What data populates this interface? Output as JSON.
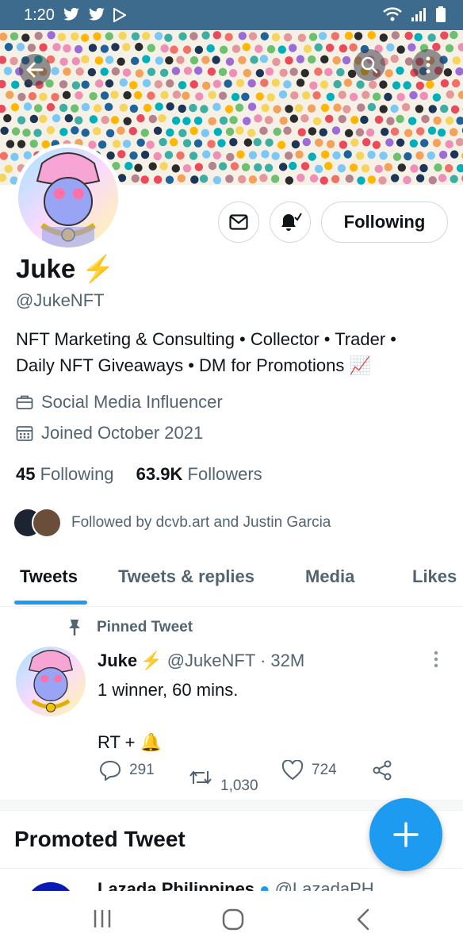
{
  "status_bar": {
    "time": "1:20"
  },
  "profile": {
    "name": "Juke",
    "emoji": "⚡",
    "handle": "@JukeNFT",
    "bio_line1": "NFT Marketing & Consulting • Collector • Trader •",
    "bio_line2": "Daily NFT Giveaways • DM for Promotions",
    "bio_emoji": "📈",
    "category": "Social Media Influencer",
    "joined": "Joined October 2021",
    "following_count": "45",
    "following_label": "Following",
    "followers_count": "63.9K",
    "followers_label": "Followers",
    "followed_by": "Followed by dcvb.art and Justin Garcia",
    "follow_button_label": "Following"
  },
  "tabs": [
    "Tweets",
    "Tweets & replies",
    "Media",
    "Likes"
  ],
  "pinned_tweet": {
    "label": "Pinned Tweet",
    "author": "Juke",
    "handle_time": "@JukeNFT · 32M",
    "line1": "1 winner, 60 mins.",
    "line2": "RT + 🔔",
    "replies": "291",
    "retweets": "1,030",
    "likes": "724"
  },
  "promoted": {
    "label": "Promoted Tweet",
    "author_preview": "Lazada Philippines",
    "handle_preview": "@LazadaPH"
  },
  "colors": {
    "accent": "#1d9bf0",
    "status_bar": "#3d6b8e",
    "bolt": "#f5b800"
  }
}
